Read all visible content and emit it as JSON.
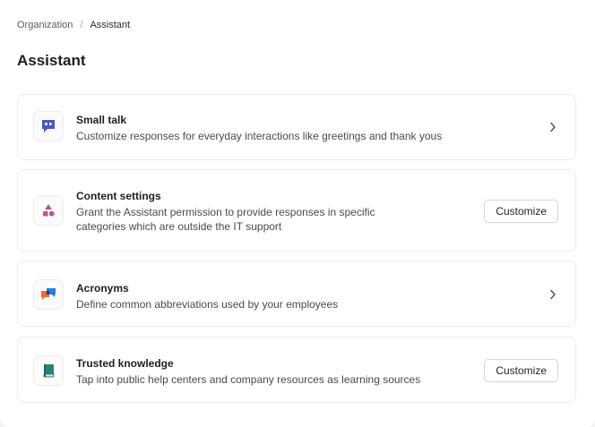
{
  "breadcrumb": {
    "parent": "Organization",
    "separator": "/",
    "current": "Assistant"
  },
  "page_title": "Assistant",
  "cards": [
    {
      "title": "Small talk",
      "description": "Customize responses for everyday interactions like greetings and thank yous",
      "icon": "quote-bubble-icon",
      "action": "chevron"
    },
    {
      "title": "Content settings",
      "description_line1": "Grant the Assistant permission to provide responses in specific",
      "description_line2": "categories which are outside the IT support",
      "icon": "shapes-icon",
      "action": "button",
      "button_label": "Customize"
    },
    {
      "title": "Acronyms",
      "description": "Define common abbreviations used by your employees",
      "icon": "chat-bubbles-icon",
      "action": "chevron"
    },
    {
      "title": "Trusted knowledge",
      "description": "Tap into public help centers and company resources as learning sources",
      "icon": "book-icon",
      "action": "button",
      "button_label": "Customize"
    }
  ],
  "colors": {
    "quote_icon": "#4a57b8",
    "shapes_icon": "#b8598a",
    "chat_orange": "#ef6a2c",
    "chat_blue": "#2a7de1",
    "book_icon": "#2f8077"
  }
}
